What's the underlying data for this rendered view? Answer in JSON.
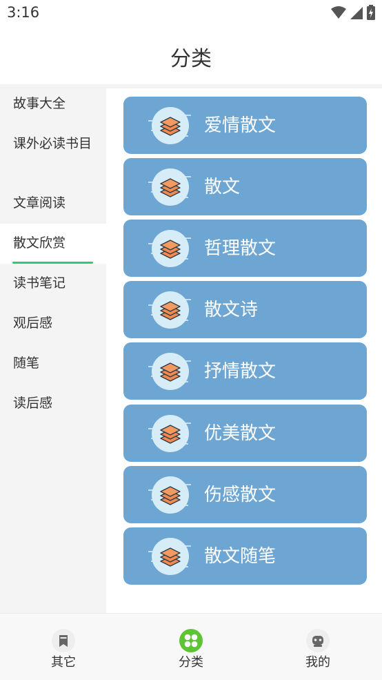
{
  "status": {
    "time": "3:16"
  },
  "header": {
    "title": "分类"
  },
  "sidebar": {
    "items": [
      {
        "label": "故事大全"
      },
      {
        "label": "课外必读书目"
      },
      {
        "label": "文章阅读"
      },
      {
        "label": "散文欣赏"
      },
      {
        "label": "读书笔记"
      },
      {
        "label": "观后感"
      },
      {
        "label": "随笔"
      },
      {
        "label": "读后感"
      }
    ],
    "active_index": 3,
    "active_color": "#2ecc71"
  },
  "categories": {
    "icon": "layers-icon",
    "items": [
      {
        "label": "爱情散文"
      },
      {
        "label": "散文"
      },
      {
        "label": "哲理散文"
      },
      {
        "label": "散文诗"
      },
      {
        "label": "抒情散文"
      },
      {
        "label": "优美散文"
      },
      {
        "label": "伤感散文"
      },
      {
        "label": "散文随笔"
      }
    ],
    "card_color": "#6ea6d3"
  },
  "bottom_nav": {
    "items": [
      {
        "label": "其它",
        "icon": "bookmark-icon"
      },
      {
        "label": "分类",
        "icon": "grid-icon"
      },
      {
        "label": "我的",
        "icon": "robot-icon"
      }
    ],
    "active_index": 1,
    "active_color": "#5cc435"
  }
}
